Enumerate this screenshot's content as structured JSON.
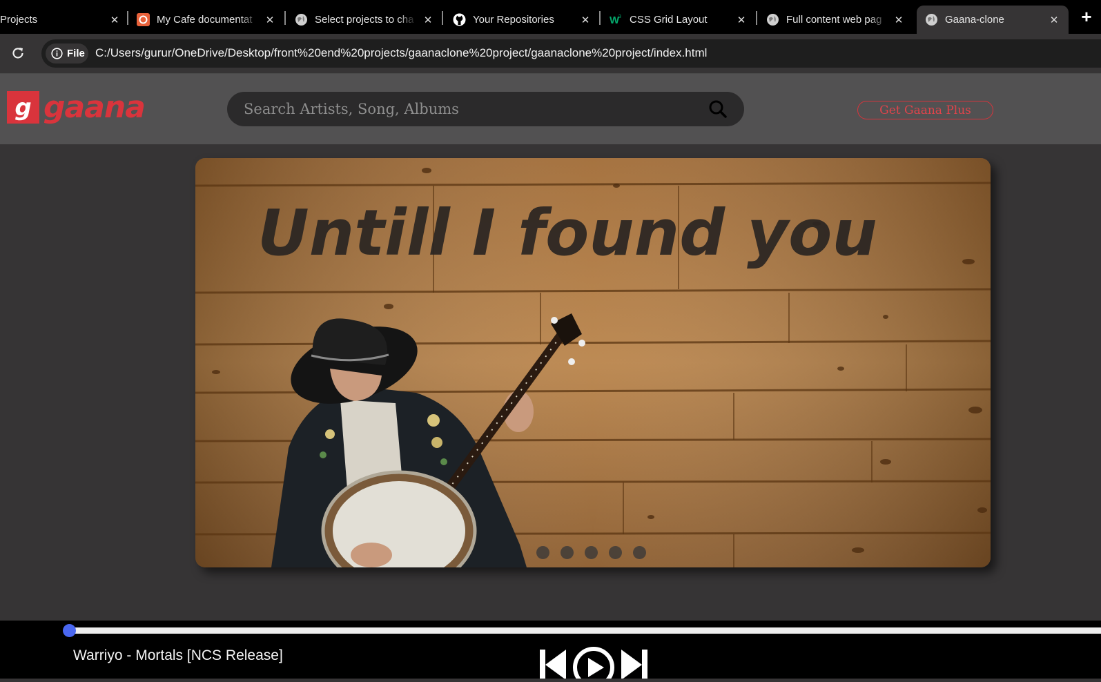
{
  "browser": {
    "tabs": [
      {
        "title": "Projects",
        "icon": "none"
      },
      {
        "title": "My Cafe documentat",
        "icon": "cafe-icon"
      },
      {
        "title": "Select projects to cha",
        "icon": "globe-icon"
      },
      {
        "title": "Your Repositories",
        "icon": "github-icon"
      },
      {
        "title": "CSS Grid Layout",
        "icon": "w3schools-icon"
      },
      {
        "title": "Full content web pag",
        "icon": "globe-icon"
      },
      {
        "title": "Gaana-clone",
        "icon": "globe-icon"
      }
    ],
    "close_glyph": "✕",
    "new_tab_glyph": "+",
    "chip_label": "File",
    "url": "C:/Users/gurur/OneDrive/Desktop/front%20end%20projects/gaanaclone%20project/gaanaclone%20project/index.html"
  },
  "header": {
    "logo_letter": "g",
    "logo_word": "gaana",
    "search_placeholder": "Search Artists, Song, Albums",
    "plus_label": "Get Gaana Plus"
  },
  "banner": {
    "title": "Untill I found you",
    "dots_count": 5,
    "active_dot": 0
  },
  "player": {
    "song": "Warriyo - Mortals [NCS Release]",
    "progress": 0.0
  },
  "colors": {
    "brand_red": "#d9343c",
    "seek_thumb": "#4a67f0",
    "header_bg": "#525152",
    "page_bg": "#363435"
  }
}
